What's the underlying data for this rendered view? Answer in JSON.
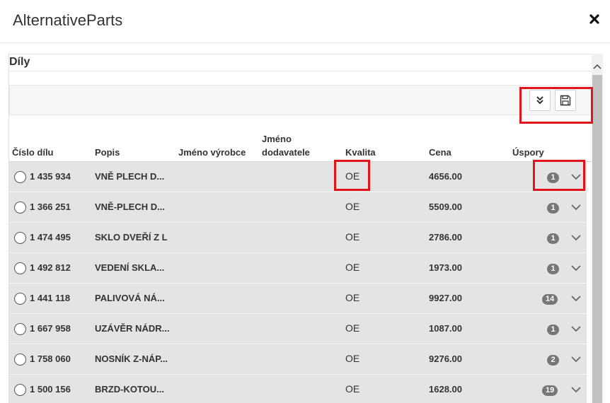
{
  "dialog": {
    "title": "AlternativeParts",
    "close_icon": "close-icon"
  },
  "section": {
    "title": "Díly"
  },
  "toolbar": {
    "expand_icon": "double-chevron-down-icon",
    "save_icon": "floppy-disk-icon"
  },
  "columns": {
    "part_no": "Číslo dílu",
    "description": "Popis",
    "manufacturer": "Jméno výrobce",
    "supplier_line1": "Jméno",
    "supplier_line2": "dodavatele",
    "quality": "Kvalita",
    "price": "Cena",
    "savings": "Úspory"
  },
  "rows": [
    {
      "part_no": "1 435 934",
      "description": "VNĚ PLECH D...",
      "quality": "OE",
      "price": "4656.00",
      "savings": "1"
    },
    {
      "part_no": "1 366 251",
      "description": "VNĚ-PLECH D...",
      "quality": "OE",
      "price": "5509.00",
      "savings": "1"
    },
    {
      "part_no": "1 474 495",
      "description": "SKLO DVEŘÍ Z L",
      "quality": "OE",
      "price": "2786.00",
      "savings": "1"
    },
    {
      "part_no": "1 492 812",
      "description": "VEDENÍ SKLA...",
      "quality": "OE",
      "price": "1973.00",
      "savings": "1"
    },
    {
      "part_no": "1 441 118",
      "description": "PALIVOVÁ NÁ...",
      "quality": "OE",
      "price": "9927.00",
      "savings": "14"
    },
    {
      "part_no": "1 667 958",
      "description": "UZÁVĚR NÁDR...",
      "quality": "OE",
      "price": "1087.00",
      "savings": "1"
    },
    {
      "part_no": "1 758 060",
      "description": "NOSNÍK Z-NÁP...",
      "quality": "OE",
      "price": "9276.00",
      "savings": "2"
    },
    {
      "part_no": "1 500 156",
      "description": "BRZD-KOTOU...",
      "quality": "OE",
      "price": "1628.00",
      "savings": "19"
    }
  ],
  "colors": {
    "highlight": "#e2141b",
    "row_bg": "#e4e4e4",
    "badge": "#777777"
  }
}
